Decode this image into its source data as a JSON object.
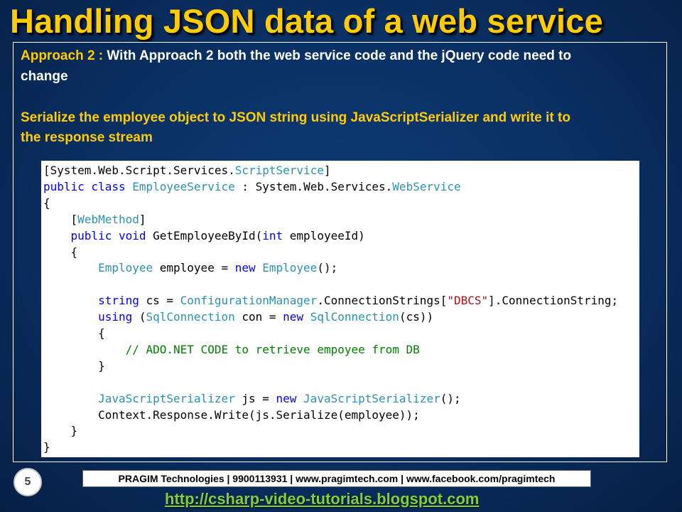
{
  "slide": {
    "title": "Handling JSON data of a web service",
    "approach_label": "Approach 2 :",
    "approach_text": "With Approach 2 both the web service code and the jQuery code need to",
    "approach_text_cont": "change",
    "serialize_line1": "Serialize the employee object to JSON string using JavaScriptSerializer and write it to",
    "serialize_line2": "the response stream",
    "page_number": "5"
  },
  "code": {
    "lines": [
      [
        {
          "t": "[System.Web.Script.Services.",
          "c": "plain"
        },
        {
          "t": "ScriptService",
          "c": "type"
        },
        {
          "t": "]",
          "c": "plain"
        }
      ],
      [
        {
          "t": "public class ",
          "c": "kw"
        },
        {
          "t": "EmployeeService",
          "c": "type"
        },
        {
          "t": " : System.Web.Services.",
          "c": "plain"
        },
        {
          "t": "WebService",
          "c": "type"
        }
      ],
      [
        {
          "t": "{",
          "c": "plain"
        }
      ],
      [
        {
          "t": "    [",
          "c": "plain"
        },
        {
          "t": "WebMethod",
          "c": "type"
        },
        {
          "t": "]",
          "c": "plain"
        }
      ],
      [
        {
          "t": "    ",
          "c": "plain"
        },
        {
          "t": "public void ",
          "c": "kw"
        },
        {
          "t": "GetEmployeeById(",
          "c": "plain"
        },
        {
          "t": "int",
          "c": "kw"
        },
        {
          "t": " employeeId)",
          "c": "plain"
        }
      ],
      [
        {
          "t": "    {",
          "c": "plain"
        }
      ],
      [
        {
          "t": "        ",
          "c": "plain"
        },
        {
          "t": "Employee",
          "c": "type"
        },
        {
          "t": " employee = ",
          "c": "plain"
        },
        {
          "t": "new ",
          "c": "kw"
        },
        {
          "t": "Employee",
          "c": "type"
        },
        {
          "t": "();",
          "c": "plain"
        }
      ],
      [],
      [
        {
          "t": "        ",
          "c": "plain"
        },
        {
          "t": "string",
          "c": "kw"
        },
        {
          "t": " cs = ",
          "c": "plain"
        },
        {
          "t": "ConfigurationManager",
          "c": "type"
        },
        {
          "t": ".ConnectionStrings[",
          "c": "plain"
        },
        {
          "t": "\"DBCS\"",
          "c": "str"
        },
        {
          "t": "].ConnectionString;",
          "c": "plain"
        }
      ],
      [
        {
          "t": "        ",
          "c": "plain"
        },
        {
          "t": "using",
          "c": "kw"
        },
        {
          "t": " (",
          "c": "plain"
        },
        {
          "t": "SqlConnection",
          "c": "type"
        },
        {
          "t": " con = ",
          "c": "plain"
        },
        {
          "t": "new ",
          "c": "kw"
        },
        {
          "t": "SqlConnection",
          "c": "type"
        },
        {
          "t": "(cs))",
          "c": "plain"
        }
      ],
      [
        {
          "t": "        {",
          "c": "plain"
        }
      ],
      [
        {
          "t": "            ",
          "c": "plain"
        },
        {
          "t": "// ADO.NET CODE to retrieve empoyee from DB",
          "c": "com"
        }
      ],
      [
        {
          "t": "        }",
          "c": "plain"
        }
      ],
      [],
      [
        {
          "t": "        ",
          "c": "plain"
        },
        {
          "t": "JavaScriptSerializer",
          "c": "type"
        },
        {
          "t": " js = ",
          "c": "plain"
        },
        {
          "t": "new ",
          "c": "kw"
        },
        {
          "t": "JavaScriptSerializer",
          "c": "type"
        },
        {
          "t": "();",
          "c": "plain"
        }
      ],
      [
        {
          "t": "        Context.Response.Write(js.Serialize(employee));",
          "c": "plain"
        }
      ],
      [
        {
          "t": "    }",
          "c": "plain"
        }
      ],
      [
        {
          "t": "}",
          "c": "plain"
        }
      ]
    ]
  },
  "footer": {
    "company_bar": "PRAGIM Technologies | 9900113931 | www.pragimtech.com | www.facebook.com/pragimtech",
    "blog_link": "http://csharp-video-tutorials.blogspot.com"
  },
  "colors": {
    "title": "#ffcc00",
    "link": "#7fd13b",
    "background": "#0a2f62",
    "code_keyword": "#0000ff",
    "code_type": "#2b91af",
    "code_string": "#a31515",
    "code_comment": "#008000"
  }
}
